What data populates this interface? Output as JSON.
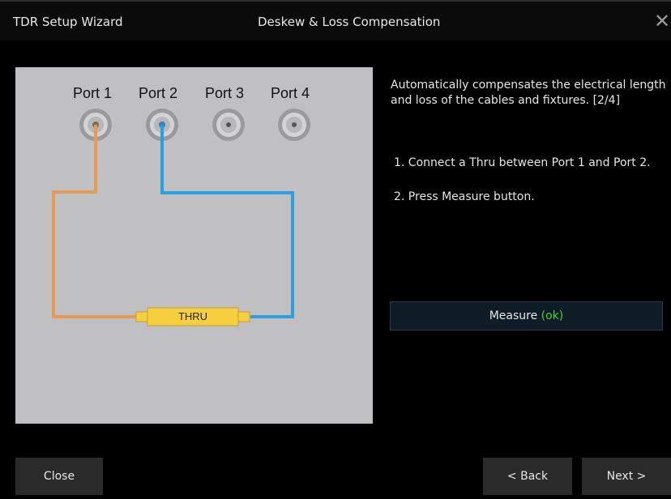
{
  "window": {
    "title": "TDR Setup Wizard",
    "step_title": "Deskew & Loss Compensation",
    "close_symbol": "✕"
  },
  "diagram": {
    "ports": [
      "Port 1",
      "Port 2",
      "Port 3",
      "Port 4"
    ],
    "thru_label": "THRU",
    "cable_colors": {
      "port1": "#e59a55",
      "port2": "#2d9ee0"
    },
    "thru_color": "#f6cf40"
  },
  "instructions": {
    "description": "Automatically compensates the electrical length and loss of the cables and fixtures. [2/4]",
    "steps": [
      "1. Connect a Thru between Port 1 and Port 2.",
      "2. Press Measure button."
    ]
  },
  "measure": {
    "label": "Measure",
    "status": "(ok)",
    "status_color": "#3dd63d"
  },
  "footer": {
    "close_label": "Close",
    "back_label": "< Back",
    "next_label": "Next >"
  }
}
